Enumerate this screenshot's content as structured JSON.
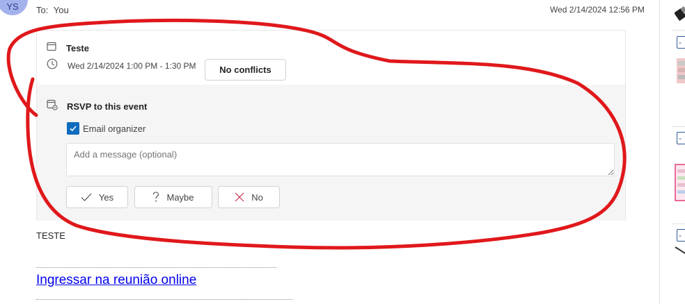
{
  "header": {
    "avatar_initials": "YS",
    "to_label": "To:",
    "to_value": "You",
    "received_date": "Wed 2/14/2024 12:56 PM"
  },
  "event": {
    "title": "Teste",
    "time": "Wed 2/14/2024 1:00 PM - 1:30 PM",
    "conflicts_label": "No conflicts"
  },
  "rsvp": {
    "heading": "RSVP to this event",
    "email_organizer_label": "Email organizer",
    "email_organizer_checked": true,
    "message_placeholder": "Add a message (optional)",
    "yes_label": "Yes",
    "maybe_label": "Maybe",
    "no_label": "No"
  },
  "body": {
    "text": "TESTE",
    "join_link": "Ingressar na reunião online"
  },
  "icons": {
    "calendar": "calendar-icon",
    "clock": "clock-icon",
    "rsvp": "calendar-rsvp-icon",
    "check": "checkmark-icon",
    "yes": "checkmark-icon",
    "maybe": "question-icon",
    "no": "x-icon"
  },
  "colors": {
    "accent": "#0f6cbd",
    "link": "#0000ee",
    "annotation": "#e0181b",
    "no_icon": "#c4314b"
  }
}
